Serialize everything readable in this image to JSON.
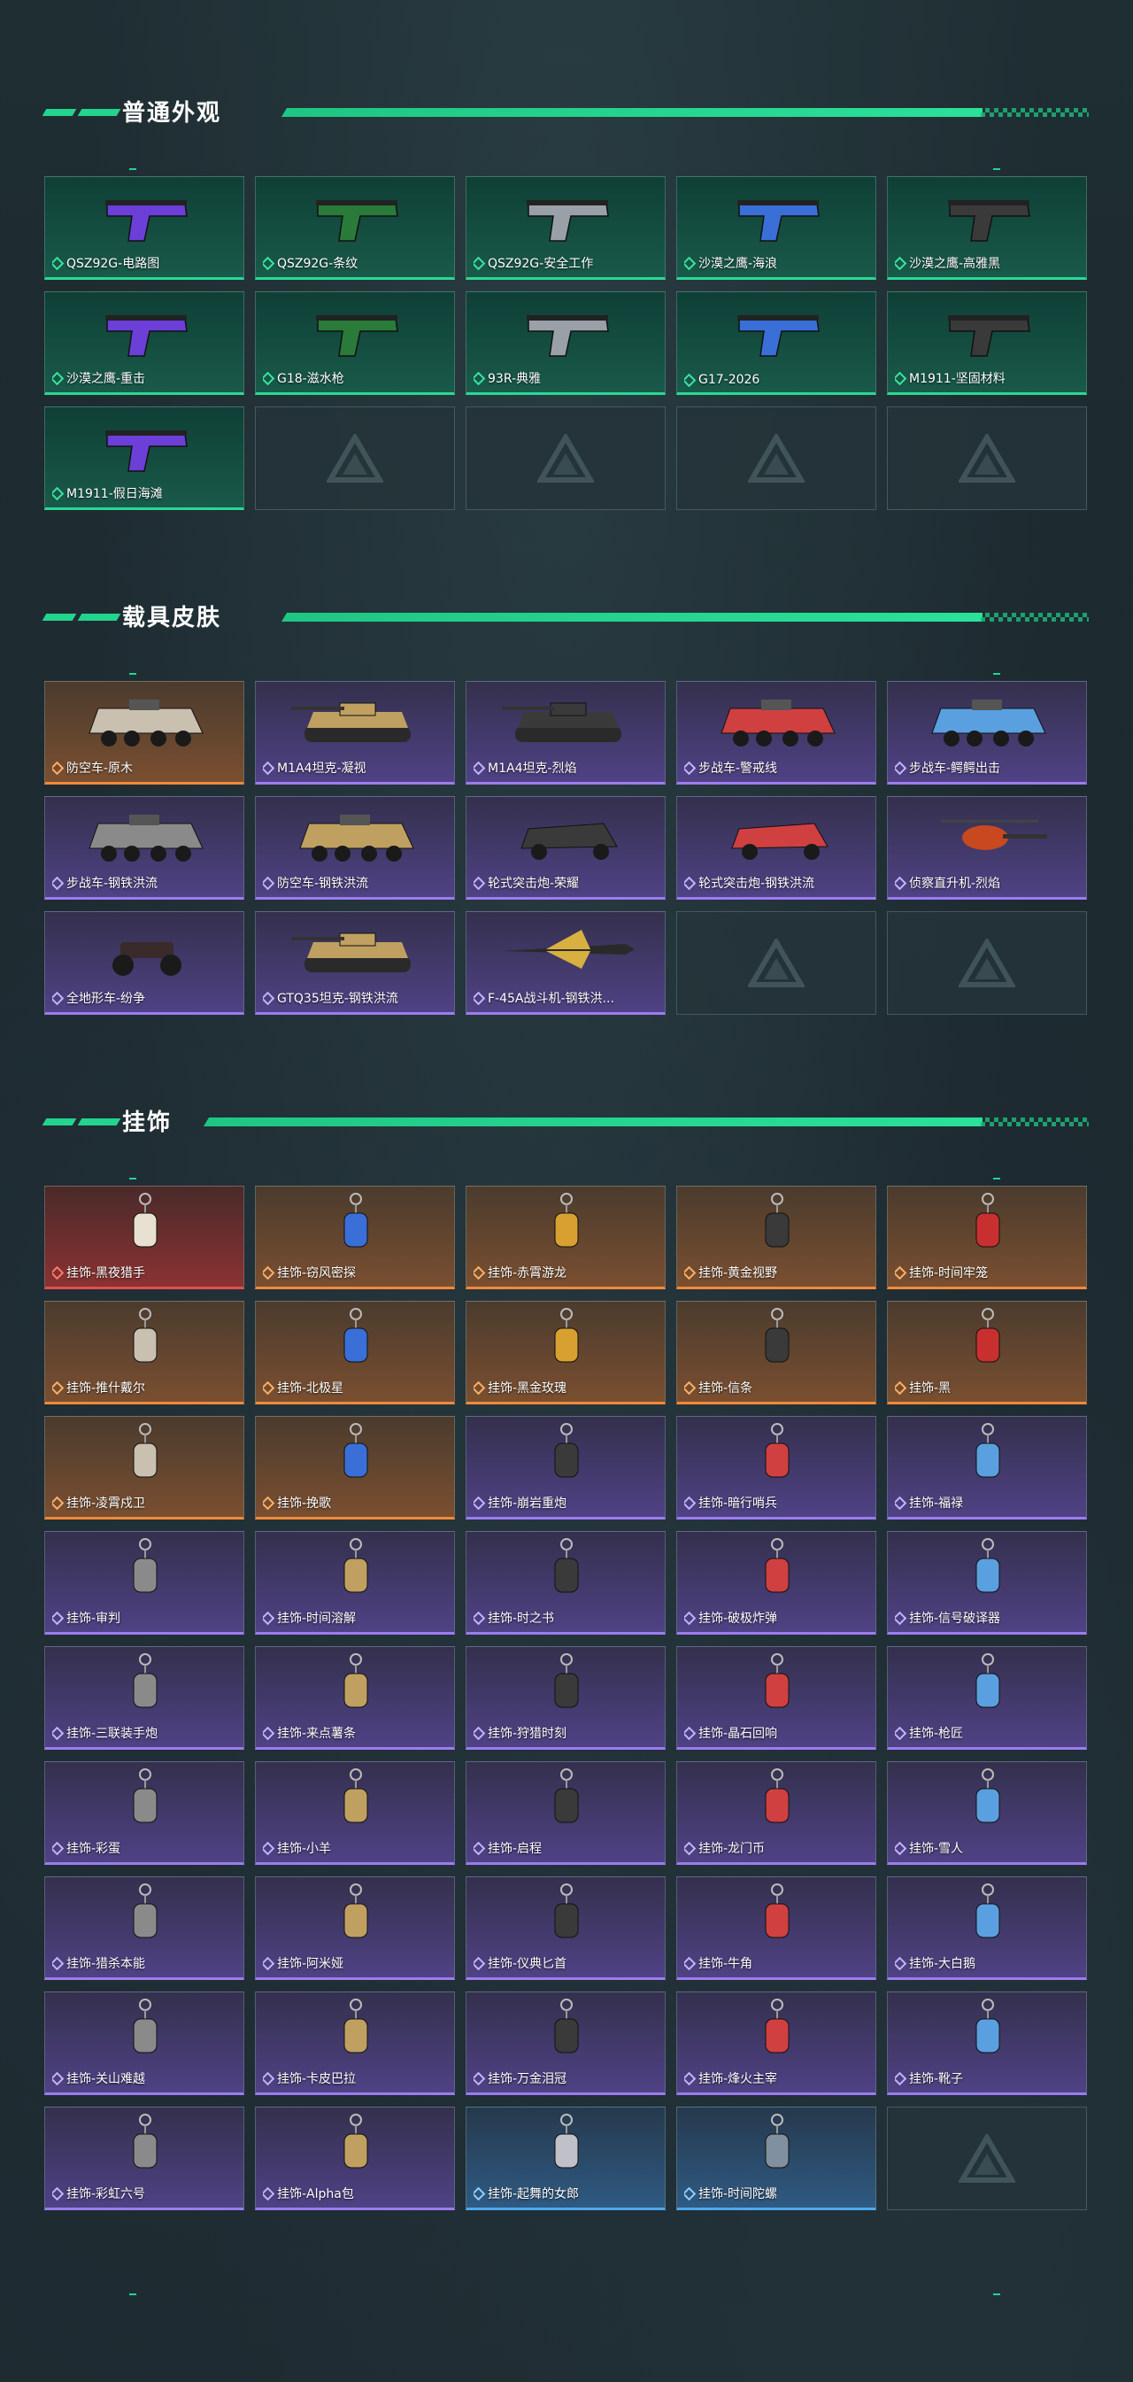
{
  "sections": {
    "weapons": {
      "title": "普通外观",
      "items": [
        {
          "label": "QSZ92G-电路图",
          "rarity": "green",
          "icon": "pistol-icon"
        },
        {
          "label": "QSZ92G-条纹",
          "rarity": "green",
          "icon": "pistol-icon"
        },
        {
          "label": "QSZ92G-安全工作",
          "rarity": "green",
          "icon": "pistol-icon"
        },
        {
          "label": "沙漠之鹰-海浪",
          "rarity": "green",
          "icon": "pistol-icon"
        },
        {
          "label": "沙漠之鹰-高雅黑",
          "rarity": "green",
          "icon": "pistol-icon"
        },
        {
          "label": "沙漠之鹰-重击",
          "rarity": "green",
          "icon": "pistol-icon"
        },
        {
          "label": "G18-滋水枪",
          "rarity": "green",
          "icon": "pistol-icon"
        },
        {
          "label": "93R-典雅",
          "rarity": "green",
          "icon": "pistol-icon"
        },
        {
          "label": "G17-2026",
          "rarity": "green",
          "icon": "pistol-icon"
        },
        {
          "label": "M1911-坚固材料",
          "rarity": "green",
          "icon": "pistol-icon"
        },
        {
          "label": "M1911-假日海滩",
          "rarity": "green",
          "icon": "pistol-icon"
        }
      ]
    },
    "vehicles": {
      "title": "载具皮肤",
      "items": [
        {
          "label": "防空车-原木",
          "rarity": "orange",
          "icon": "armored-vehicle-icon"
        },
        {
          "label": "M1A4坦克-凝视",
          "rarity": "purple",
          "icon": "tank-icon"
        },
        {
          "label": "M1A4坦克-烈焰",
          "rarity": "purple",
          "icon": "tank-icon"
        },
        {
          "label": "步战车-警戒线",
          "rarity": "purple",
          "icon": "armored-vehicle-icon"
        },
        {
          "label": "步战车-鳄鳄出击",
          "rarity": "purple",
          "icon": "armored-vehicle-icon"
        },
        {
          "label": "步战车-钢铁洪流",
          "rarity": "purple",
          "icon": "armored-vehicle-icon"
        },
        {
          "label": "防空车-钢铁洪流",
          "rarity": "purple",
          "icon": "armored-vehicle-icon"
        },
        {
          "label": "轮式突击炮-荣耀",
          "rarity": "purple",
          "icon": "wheeled-vehicle-icon"
        },
        {
          "label": "轮式突击炮-钢铁洪流",
          "rarity": "purple",
          "icon": "wheeled-vehicle-icon"
        },
        {
          "label": "侦察直升机-烈焰",
          "rarity": "purple",
          "icon": "helicopter-icon"
        },
        {
          "label": "全地形车-纷争",
          "rarity": "purple",
          "icon": "atv-icon"
        },
        {
          "label": "GTQ35坦克-钢铁洪流",
          "rarity": "purple",
          "icon": "tank-icon"
        },
        {
          "label": "F-45A战斗机-钢铁洪...",
          "rarity": "purple",
          "icon": "jet-icon"
        }
      ]
    },
    "charms": {
      "title": "挂饰",
      "items": [
        {
          "label": "挂饰-黑夜猎手",
          "rarity": "red",
          "icon": "charm-icon"
        },
        {
          "label": "挂饰-窃风密探",
          "rarity": "orange",
          "icon": "charm-icon"
        },
        {
          "label": "挂饰-赤霄游龙",
          "rarity": "orange",
          "icon": "charm-icon"
        },
        {
          "label": "挂饰-黄金视野",
          "rarity": "orange",
          "icon": "charm-icon"
        },
        {
          "label": "挂饰-时间牢笼",
          "rarity": "orange",
          "icon": "charm-icon"
        },
        {
          "label": "挂饰-推什戴尔",
          "rarity": "orange",
          "icon": "charm-icon"
        },
        {
          "label": "挂饰-北极星",
          "rarity": "orange",
          "icon": "charm-icon"
        },
        {
          "label": "挂饰-黑金玫瑰",
          "rarity": "orange",
          "icon": "charm-icon"
        },
        {
          "label": "挂饰-信条",
          "rarity": "orange",
          "icon": "charm-icon"
        },
        {
          "label": "挂饰-黑",
          "rarity": "orange",
          "icon": "charm-icon"
        },
        {
          "label": "挂饰-凌霄戍卫",
          "rarity": "orange",
          "icon": "charm-icon"
        },
        {
          "label": "挂饰-挽歌",
          "rarity": "orange",
          "icon": "charm-icon"
        },
        {
          "label": "挂饰-崩岩重炮",
          "rarity": "purple",
          "icon": "charm-icon"
        },
        {
          "label": "挂饰-暗行哨兵",
          "rarity": "purple",
          "icon": "charm-icon"
        },
        {
          "label": "挂饰-福禄",
          "rarity": "purple",
          "icon": "charm-icon"
        },
        {
          "label": "挂饰-审判",
          "rarity": "purple",
          "icon": "charm-icon"
        },
        {
          "label": "挂饰-时间溶解",
          "rarity": "purple",
          "icon": "charm-icon"
        },
        {
          "label": "挂饰-时之书",
          "rarity": "purple",
          "icon": "charm-icon"
        },
        {
          "label": "挂饰-破极炸弹",
          "rarity": "purple",
          "icon": "charm-icon"
        },
        {
          "label": "挂饰-信号破译器",
          "rarity": "purple",
          "icon": "charm-icon"
        },
        {
          "label": "挂饰-三联装手炮",
          "rarity": "purple",
          "icon": "charm-icon"
        },
        {
          "label": "挂饰-来点薯条",
          "rarity": "purple",
          "icon": "charm-icon"
        },
        {
          "label": "挂饰-狩猎时刻",
          "rarity": "purple",
          "icon": "charm-icon"
        },
        {
          "label": "挂饰-晶石回响",
          "rarity": "purple",
          "icon": "charm-icon"
        },
        {
          "label": "挂饰-枪匠",
          "rarity": "purple",
          "icon": "charm-icon"
        },
        {
          "label": "挂饰-彩蛋",
          "rarity": "purple",
          "icon": "charm-icon"
        },
        {
          "label": "挂饰-小羊",
          "rarity": "purple",
          "icon": "charm-icon"
        },
        {
          "label": "挂饰-启程",
          "rarity": "purple",
          "icon": "charm-icon"
        },
        {
          "label": "挂饰-龙门币",
          "rarity": "purple",
          "icon": "charm-icon"
        },
        {
          "label": "挂饰-雪人",
          "rarity": "purple",
          "icon": "charm-icon"
        },
        {
          "label": "挂饰-猎杀本能",
          "rarity": "purple",
          "icon": "charm-icon"
        },
        {
          "label": "挂饰-阿米娅",
          "rarity": "purple",
          "icon": "charm-icon"
        },
        {
          "label": "挂饰-仪典匕首",
          "rarity": "purple",
          "icon": "charm-icon"
        },
        {
          "label": "挂饰-牛角",
          "rarity": "purple",
          "icon": "charm-icon"
        },
        {
          "label": "挂饰-大白鹅",
          "rarity": "purple",
          "icon": "charm-icon"
        },
        {
          "label": "挂饰-关山难越",
          "rarity": "purple",
          "icon": "charm-icon"
        },
        {
          "label": "挂饰-卡皮巴拉",
          "rarity": "purple",
          "icon": "charm-icon"
        },
        {
          "label": "挂饰-万金泪冠",
          "rarity": "purple",
          "icon": "charm-icon"
        },
        {
          "label": "挂饰-烽火主宰",
          "rarity": "purple",
          "icon": "charm-icon"
        },
        {
          "label": "挂饰-靴子",
          "rarity": "purple",
          "icon": "charm-icon"
        },
        {
          "label": "挂饰-彩虹六号",
          "rarity": "purple",
          "icon": "charm-icon"
        },
        {
          "label": "挂饰-Alpha包",
          "rarity": "purple",
          "icon": "charm-icon"
        },
        {
          "label": "挂饰-起舞的女郎",
          "rarity": "blue",
          "icon": "charm-icon"
        },
        {
          "label": "挂饰-时间陀螺",
          "rarity": "blue",
          "icon": "charm-icon"
        }
      ]
    }
  },
  "colors": {
    "accent": "#23d48f",
    "green": "#2ad894",
    "orange": "#f08a3a",
    "red": "#e0504a",
    "purple": "#9c7cf0",
    "blue": "#4ea9f0"
  }
}
